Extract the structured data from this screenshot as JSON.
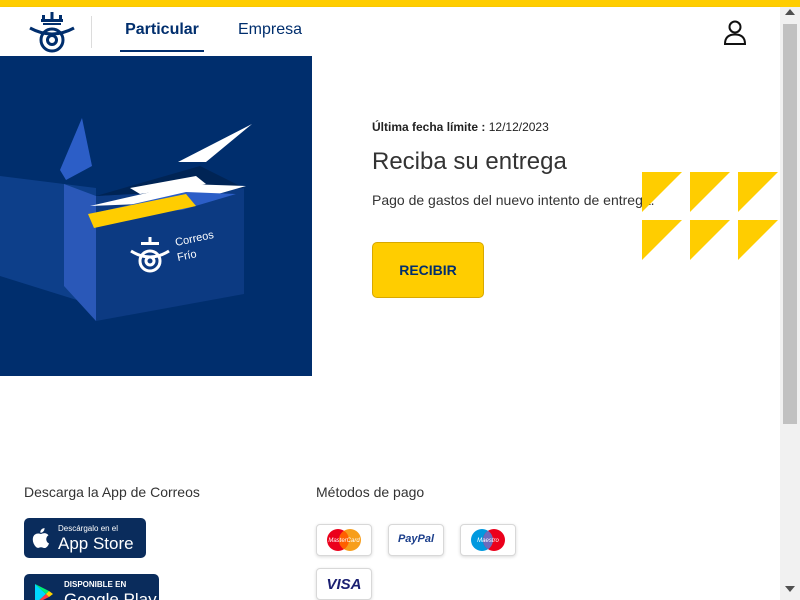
{
  "header": {
    "tabs": [
      {
        "label": "Particular",
        "active": true
      },
      {
        "label": "Empresa",
        "active": false
      }
    ]
  },
  "hero": {
    "deadline_label": "Última fecha límite :",
    "deadline_value": "12/12/2023",
    "title": "Reciba su entrega",
    "description": "Pago de gastos del nuevo intento de entrega.",
    "button_label": "RECIBIR",
    "image_text_line1": "Correos",
    "image_text_line2": "Frío"
  },
  "footer": {
    "app_heading": "Descarga la App de Correos",
    "app_store": {
      "small": "Descárgalo en el",
      "big": "App Store"
    },
    "google_play": {
      "small": "DISPONIBLE EN",
      "big": "Google Play"
    },
    "payment_heading": "Métodos de pago",
    "payment_methods": [
      "MasterCard",
      "PayPal",
      "Maestro",
      "VISA"
    ]
  },
  "colors": {
    "brand_yellow": "#ffcd00",
    "brand_blue": "#002e6d"
  }
}
